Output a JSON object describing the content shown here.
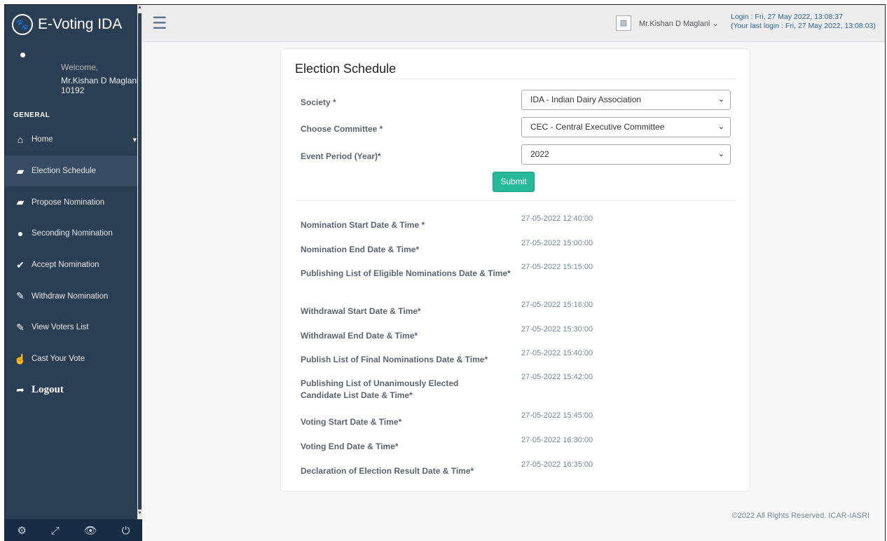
{
  "app": {
    "title": "E-Voting IDA",
    "logo_icon": "paw-icon"
  },
  "profile": {
    "welcome": "Welcome,",
    "name": "Mr.Kishan D Maglani",
    "id": "10192"
  },
  "sidebar": {
    "section": "GENERAL",
    "items": [
      {
        "label": "Home",
        "icon": "⌂"
      },
      {
        "label": "Election Schedule",
        "icon": "▰"
      },
      {
        "label": "Propose Nomination",
        "icon": "▰"
      },
      {
        "label": "Seconding Nomination",
        "icon": "●"
      },
      {
        "label": "Accept Nomination",
        "icon": "✔"
      },
      {
        "label": "Withdraw Nomination",
        "icon": "✎"
      },
      {
        "label": "View Voters List",
        "icon": "✎"
      },
      {
        "label": "Cast Your Vote",
        "icon": "☝"
      },
      {
        "label": "Logout",
        "icon": "➦"
      }
    ],
    "footer_icons": [
      "⚙",
      "⤢",
      "👁",
      "⏻"
    ]
  },
  "topbar": {
    "user_name": "Mr.Kishan D Maglani",
    "login_label": "Login",
    "login_time": ": Fri, 27 May 2022, 13:08:37",
    "last_login_label": "(Your last login",
    "last_login_time": ": Fri, 27 May 2022, 13:08:03)"
  },
  "page": {
    "title": "Election Schedule",
    "form": {
      "society_label": "Society *",
      "society_value": "IDA - Indian Dairy Association",
      "committee_label": "Choose Committee *",
      "committee_value": "CEC - Central Executive Committee",
      "period_label": "Event Period (Year)*",
      "period_value": "2022",
      "submit": "Submit"
    },
    "schedule": [
      {
        "label": "Nomination Start Date & Time *",
        "value": "27-05-2022 12:40:00"
      },
      {
        "label": "Nomination End Date & Time*",
        "value": "27-05-2022 15:00:00"
      },
      {
        "label": "Publishing List of Eligible Nominations Date & Time*",
        "value": "27-05-2022 15:15:00"
      },
      {
        "label": "Withdrawal Start Date & Time*",
        "value": "27-05-2022 15:16:00"
      },
      {
        "label": "Withdrawal End Date & Time*",
        "value": "27-05-2022 15:30:00"
      },
      {
        "label": "Publish List of Final Nominations Date & Time*",
        "value": "27-05-2022 15:40:00"
      },
      {
        "label": "Publishing List of Unanimously Elected Candidate List Date & Time*",
        "value": "27-05-2022 15:42:00"
      },
      {
        "label": "Voting Start Date & Time*",
        "value": "27-05-2022 15:45:00"
      },
      {
        "label": "Voting End Date & Time*",
        "value": "27-05-2022 16:30:00"
      },
      {
        "label": "Declaration of Election Result Date & Time*",
        "value": "27-05-2022 16:35:00"
      }
    ]
  },
  "footer": {
    "copyright": "©2022 All Rights Reserved. ICAR-IASRI"
  }
}
